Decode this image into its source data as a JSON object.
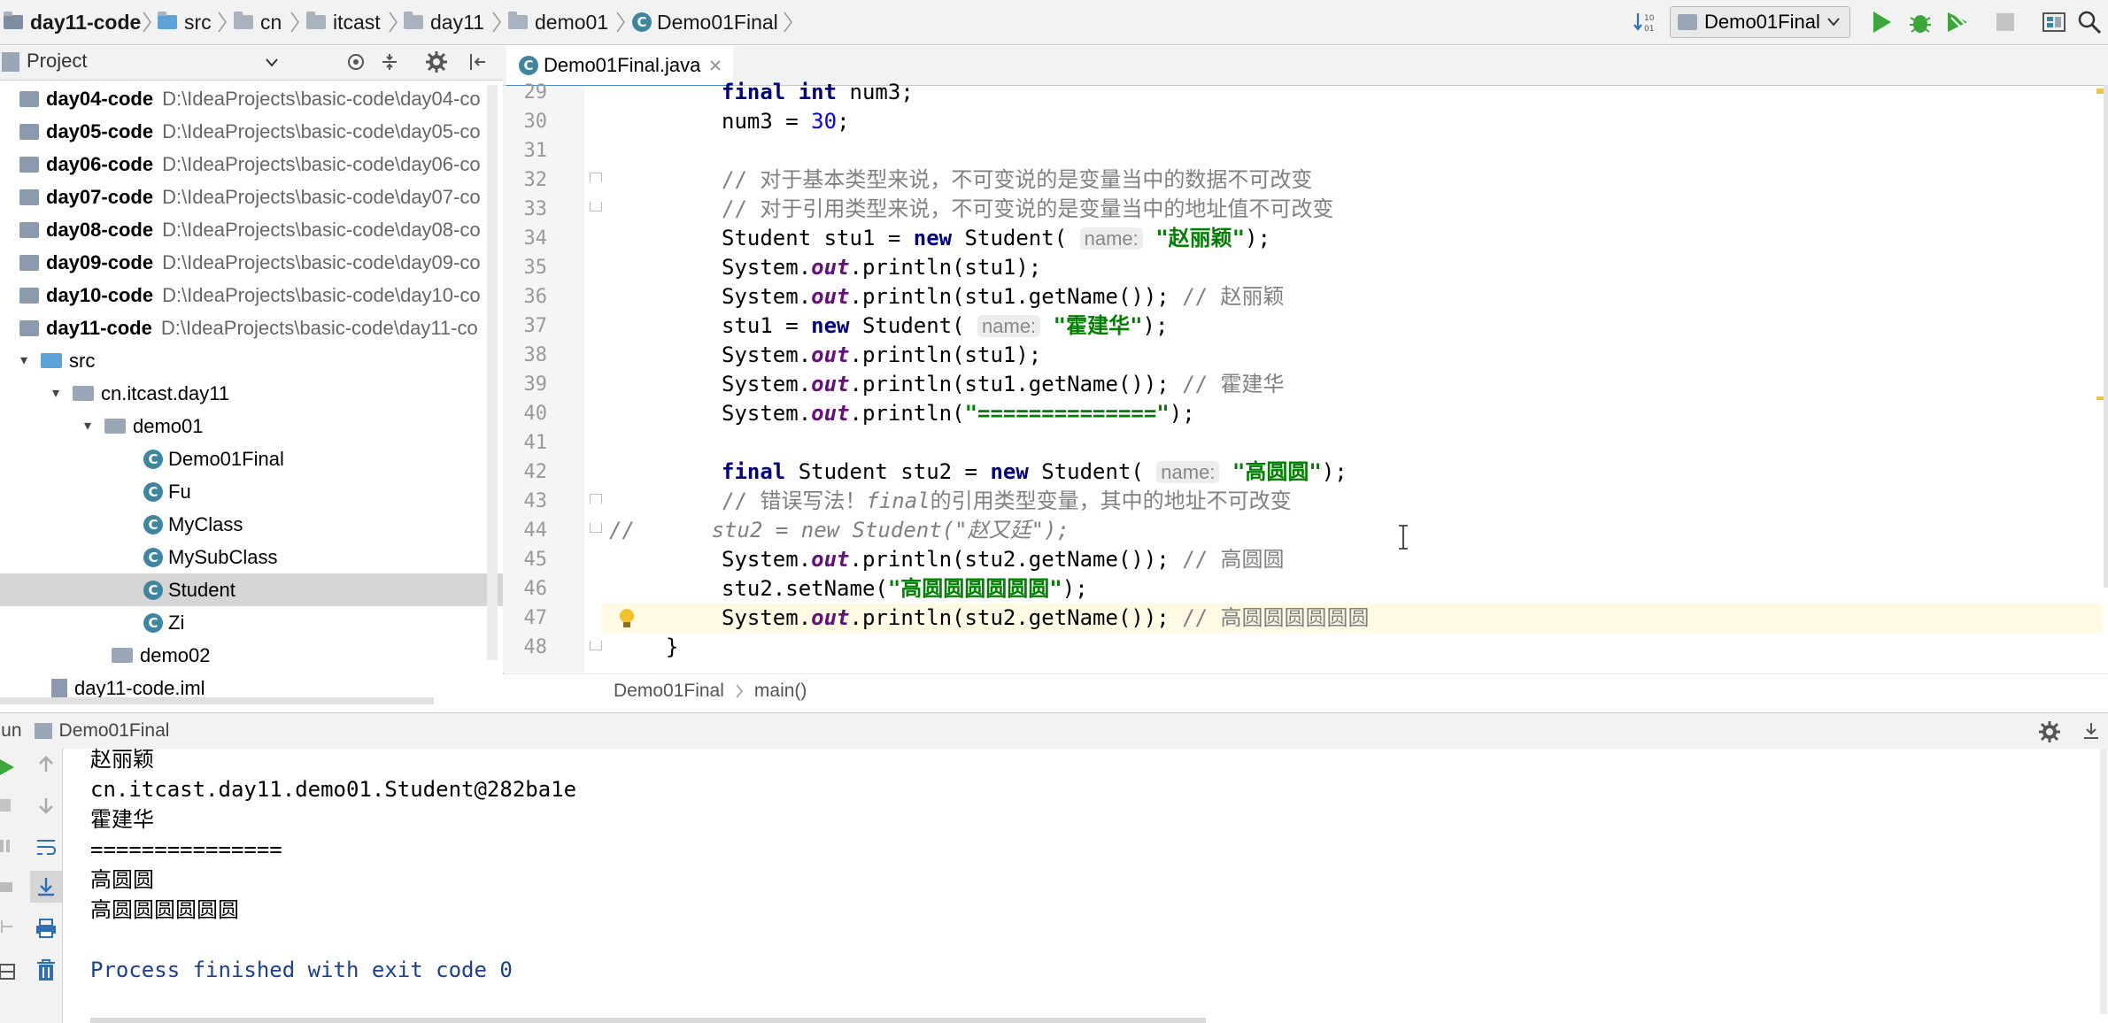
{
  "breadcrumbs": [
    {
      "label": "day11-code",
      "bold": true
    },
    {
      "label": "src"
    },
    {
      "label": "cn"
    },
    {
      "label": "itcast"
    },
    {
      "label": "day11"
    },
    {
      "label": "demo01"
    },
    {
      "label": "Demo01Final"
    }
  ],
  "toolbar": {
    "run_config": "Demo01Final",
    "accent": "#3ba73b"
  },
  "project": {
    "title": "Project",
    "modules": [
      {
        "name": "day04-code",
        "path": "D:\\IdeaProjects\\basic-code\\day04-co"
      },
      {
        "name": "day05-code",
        "path": "D:\\IdeaProjects\\basic-code\\day05-co"
      },
      {
        "name": "day06-code",
        "path": "D:\\IdeaProjects\\basic-code\\day06-co"
      },
      {
        "name": "day07-code",
        "path": "D:\\IdeaProjects\\basic-code\\day07-co"
      },
      {
        "name": "day08-code",
        "path": "D:\\IdeaProjects\\basic-code\\day08-co"
      },
      {
        "name": "day09-code",
        "path": "D:\\IdeaProjects\\basic-code\\day09-co"
      },
      {
        "name": "day10-code",
        "path": "D:\\IdeaProjects\\basic-code\\day10-co"
      },
      {
        "name": "day11-code",
        "path": "D:\\IdeaProjects\\basic-code\\day11-co"
      }
    ],
    "src": "src",
    "package": "cn.itcast.day11",
    "demo01": "demo01",
    "classes": [
      "Demo01Final",
      "Fu",
      "MyClass",
      "MySubClass",
      "Student",
      "Zi"
    ],
    "selected": "Student",
    "demo02": "demo02",
    "iml": "day11-code.iml"
  },
  "editor": {
    "tab_label": "Demo01Final.java",
    "line_numbers": [
      "29",
      "30",
      "31",
      "32",
      "33",
      "34",
      "35",
      "36",
      "37",
      "38",
      "39",
      "40",
      "41",
      "42",
      "43",
      "44",
      "45",
      "46",
      "47",
      "48"
    ],
    "t": {
      "final": "final",
      "int": "int",
      "num3": "num3;",
      "num3_assign": "num3 = ",
      "thirty": "30",
      "semi": ";",
      "c32": "// 对于基本类型来说，不可变说的是变量当中的数据不可改变",
      "c33": "// 对于引用类型来说，不可变说的是变量当中的地址值不可改变",
      "student_decl": "Student stu1 = ",
      "new": "new",
      "student_open": " Student(",
      "hint": "name:",
      "s_zhao": "\"赵丽颖\"",
      "close": ");",
      "sys": "System.",
      "out": "out",
      "println_stu1": ".println(stu1);",
      "println_getname1": ".println(stu1.getName()); ",
      "cm_zhao": "// 赵丽颖",
      "stu1_assign": "stu1 = ",
      "s_huo": "\"霍建华\"",
      "cm_huo": "// 霍建华",
      "println_open": ".println(",
      "s_eq": "\"==============\"",
      "student_stu2": " Student stu2 = ",
      "s_gao": "\"高圆圆\"",
      "c43a": "// 错误写法！",
      "c43b": "final",
      "c43c": "的引用类型变量，其中的地址不可改变",
      "c44a": "//",
      "c44b": "      stu2 = new Student(\"赵又廷\");",
      "println_getname2": ".println(stu2.getName()); ",
      "cm_gao": "// 高圆圆",
      "setname": "stu2.setName(",
      "s_gao_long": "\"高圆圆圆圆圆圆\"",
      "cm_gao_long": "// 高圆圆圆圆圆圆",
      "brace": "}"
    },
    "breadcrumb": [
      "Demo01Final",
      "main()"
    ]
  },
  "run": {
    "label": "Run",
    "config": "Demo01Final",
    "output": [
      "赵丽颖",
      "cn.itcast.day11.demo01.Student@282ba1e",
      "霍建华",
      "===============",
      "高圆圆",
      "高圆圆圆圆圆圆",
      "",
      "Process finished with exit code 0"
    ]
  }
}
